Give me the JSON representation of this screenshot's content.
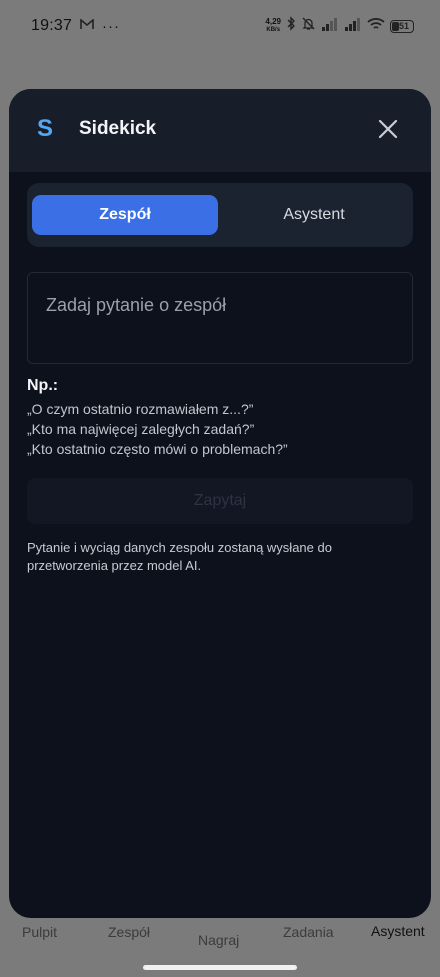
{
  "status_bar": {
    "time": "19:37",
    "notification_icons": [
      "gmail-icon"
    ],
    "more": "···",
    "net_speed_value": "4,29",
    "net_speed_unit": "KB/s",
    "battery": "51"
  },
  "modal": {
    "logo": "S",
    "title": "Sidekick",
    "tabs": [
      {
        "label": "Zespół",
        "active": true
      },
      {
        "label": "Asystent",
        "active": false
      }
    ],
    "input_placeholder": "Zadaj pytanie o zespół",
    "examples_heading": "Np.:",
    "examples": [
      "„O czym ostatnio rozmawiałem z...?”",
      "„Kto ma najwięcej zaległych zadań?”",
      "„Kto ostatnio często mówi o problemach?”"
    ],
    "submit_label": "Zapytaj",
    "disclaimer": "Pytanie i wyciąg danych zespołu zostaną wysłane do przetworzenia przez model AI."
  },
  "bottom_nav": {
    "items": [
      "Pulpit",
      "Zespół",
      "Nagraj",
      "Zadania",
      "Asystent"
    ],
    "active": "Asystent"
  },
  "colors": {
    "accent": "#3a6fe6",
    "logo": "#54a7f2",
    "modal_bg": "#0c111c",
    "scrim": "#7c7b7b"
  }
}
